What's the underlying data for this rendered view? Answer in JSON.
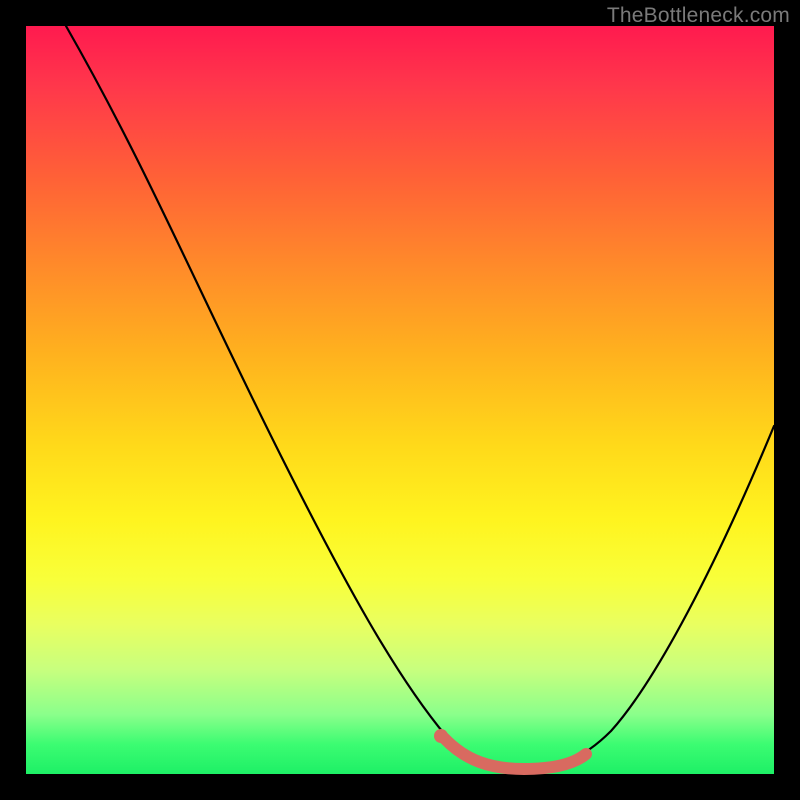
{
  "watermark": "TheBottleneck.com",
  "colors": {
    "background": "#000000",
    "curve_stroke": "#000000",
    "accent_stroke": "#d86a60",
    "gradient_top": "#ff1a4f",
    "gradient_bottom": "#1ef066"
  },
  "chart_data": {
    "type": "line",
    "title": "",
    "xlabel": "",
    "ylabel": "",
    "xlim": [
      0,
      100
    ],
    "ylim": [
      0,
      100
    ],
    "grid": false,
    "legend": false,
    "series": [
      {
        "name": "bottleneck-curve",
        "x": [
          0,
          5,
          10,
          15,
          20,
          25,
          30,
          35,
          40,
          45,
          50,
          54,
          58,
          62,
          66,
          70,
          74,
          78,
          82,
          86,
          90,
          94,
          98,
          100
        ],
        "y": [
          100,
          94,
          88,
          80,
          72,
          63,
          54,
          45,
          36,
          27,
          18,
          11,
          5,
          2,
          1,
          1,
          2,
          5,
          10,
          17,
          25,
          33,
          42,
          47
        ]
      }
    ],
    "annotations": [
      {
        "name": "bottom-highlight",
        "type": "segment",
        "x": [
          54,
          72
        ],
        "y": [
          3,
          3
        ]
      }
    ]
  }
}
